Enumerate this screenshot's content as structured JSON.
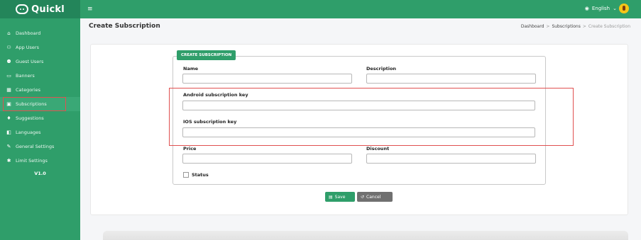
{
  "brand": {
    "name": "Quickl"
  },
  "sidebar": {
    "items": [
      {
        "label": "Dashboard",
        "icon": "home-icon"
      },
      {
        "label": "App Users",
        "icon": "users-icon"
      },
      {
        "label": "Guest Users",
        "icon": "guest-users-icon"
      },
      {
        "label": "Banners",
        "icon": "banner-icon"
      },
      {
        "label": "Categories",
        "icon": "grid-icon"
      },
      {
        "label": "Subscriptions",
        "icon": "card-icon",
        "active": true
      },
      {
        "label": "Suggestions",
        "icon": "bulb-icon"
      },
      {
        "label": "Languages",
        "icon": "translate-icon"
      },
      {
        "label": "General Settings",
        "icon": "wrench-icon"
      },
      {
        "label": "Limit Settings",
        "icon": "gear-icon"
      }
    ],
    "version": "V1.0"
  },
  "topbar": {
    "language": "English",
    "menu_icon": "hamburger-icon"
  },
  "page": {
    "title": "Create Subscription",
    "breadcrumb": [
      "Dashboard",
      "Subscriptions",
      "Create Subscription"
    ]
  },
  "form": {
    "legend": "CREATE SUBSCRIPTION",
    "name_label": "Name",
    "name_value": "",
    "description_label": "Description",
    "description_value": "",
    "android_label": "Android subscription key",
    "android_value": "",
    "ios_label": "IOS subscription key",
    "ios_value": "",
    "price_label": "Price",
    "price_value": "",
    "discount_label": "Discount",
    "discount_value": "",
    "status_label": "Status",
    "status_checked": false,
    "save_label": "Save",
    "cancel_label": "Cancel"
  },
  "colors": {
    "primary": "#2f9e6a",
    "highlight": "#e05050",
    "cancel": "#707070"
  }
}
